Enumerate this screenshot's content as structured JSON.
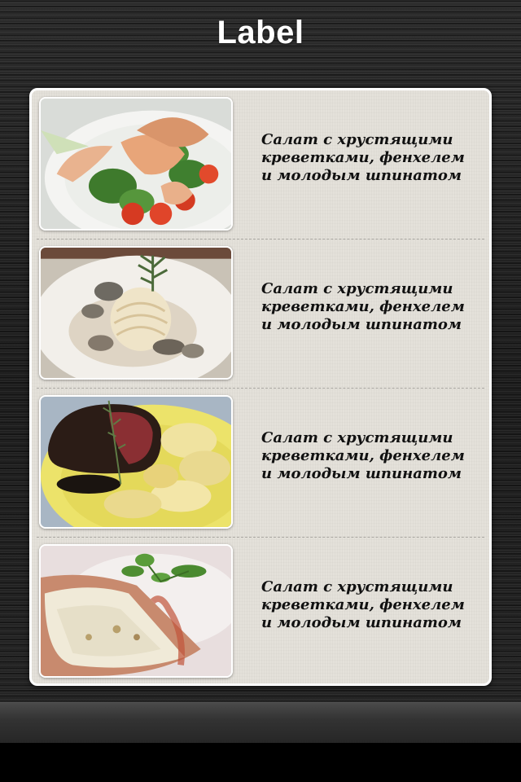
{
  "header": {
    "title": "Label"
  },
  "menu": {
    "items": [
      {
        "image": "shrimp-spinach-salad-photo",
        "description": "Салат с хрустящими\nкреветками, фенхелем\nи молодым шпинатом"
      },
      {
        "image": "pasta-mushroom-cream-photo",
        "description": "Салат с хрустящими\nкреветками, фенхелем\nи молодым шпинатом"
      },
      {
        "image": "steak-potatoes-photo",
        "description": "Салат с хрустящими\nкреветками, фенхелем\nи молодым шпинатом"
      },
      {
        "image": "baked-dish-mint-photo",
        "description": "Салат с хрустящими\nкреветками, фенхелем\nи молодым шпинатом"
      }
    ]
  },
  "colors": {
    "background": "#222222",
    "card": "#e4e1da",
    "card_border": "#ffffff",
    "title_text": "#ffffff",
    "description_text": "#111111"
  }
}
